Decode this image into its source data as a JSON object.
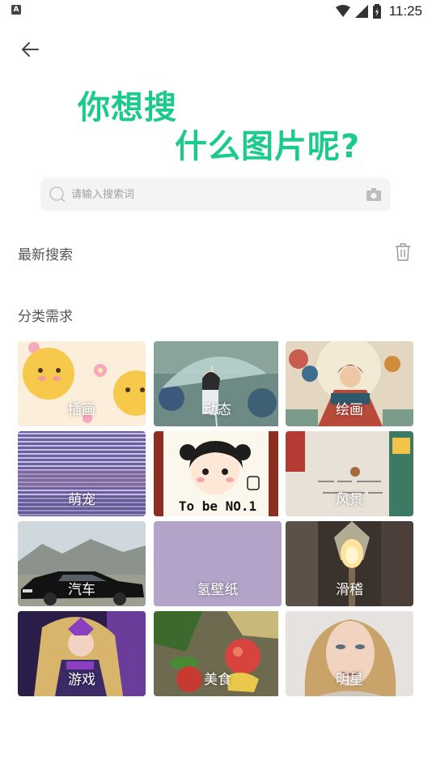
{
  "status_bar": {
    "notification_glyph": "A",
    "time": "11:25"
  },
  "hero": {
    "line1": "你想搜",
    "line2": "什么图片呢?"
  },
  "search": {
    "placeholder": "请输入搜索词"
  },
  "recent": {
    "title": "最新搜索"
  },
  "categories": {
    "title": "分类需求",
    "items": [
      {
        "label": "插画"
      },
      {
        "label": "动态"
      },
      {
        "label": "绘画"
      },
      {
        "label": "萌宠"
      },
      {
        "label": "To be NO.1"
      },
      {
        "label": "风景"
      },
      {
        "label": "汽车"
      },
      {
        "label": "氢壁纸"
      },
      {
        "label": "滑稽"
      },
      {
        "label": "游戏"
      },
      {
        "label": "美食"
      },
      {
        "label": "明星"
      }
    ]
  },
  "colors": {
    "accent": "#1ccb8b"
  }
}
